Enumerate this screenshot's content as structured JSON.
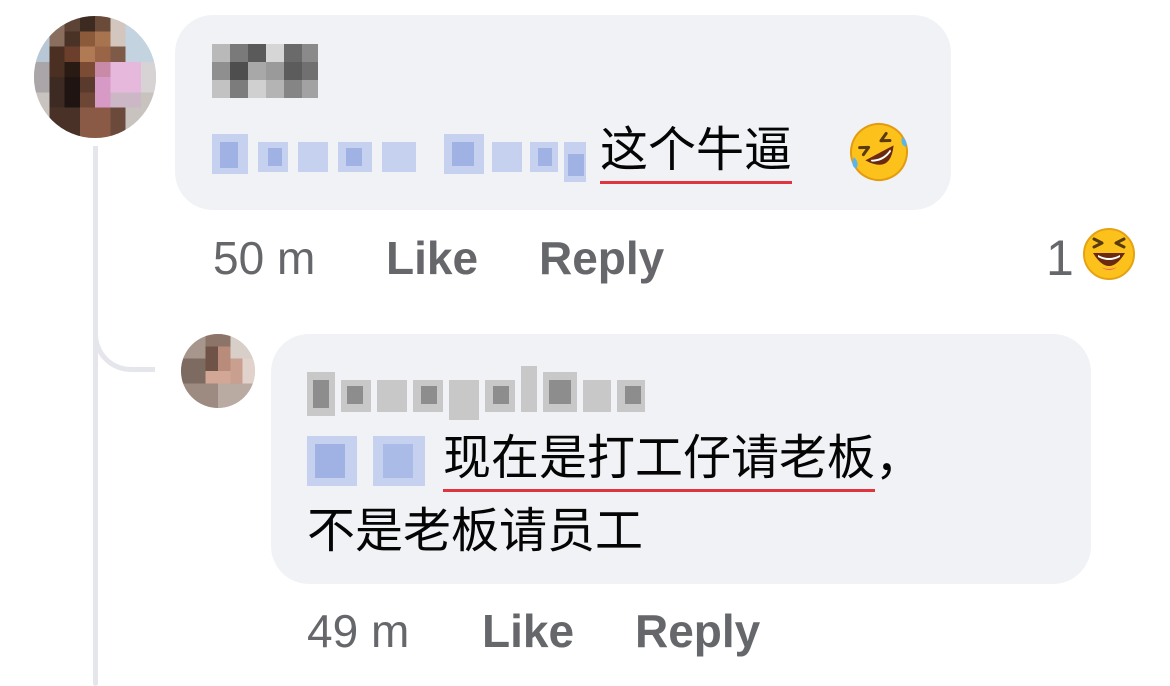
{
  "comment_1": {
    "text": "这个牛逼",
    "emoji_icon": "rolling-on-floor-laughing",
    "time": "50 m",
    "like_label": "Like",
    "reply_label": "Reply",
    "reaction_count": "1",
    "reaction_icon": "laughing-face"
  },
  "reply_1": {
    "text_line_1": "现在是打工仔请老板",
    "text_line_1_punct": "，",
    "text_line_2": "不是老板请员工",
    "time": "49 m",
    "like_label": "Like",
    "reply_label": "Reply"
  },
  "colors": {
    "bubble": "#f0f2f5",
    "meta_text": "#65676b",
    "underline": "#e0343f",
    "mention_blur": "#aebde6"
  }
}
